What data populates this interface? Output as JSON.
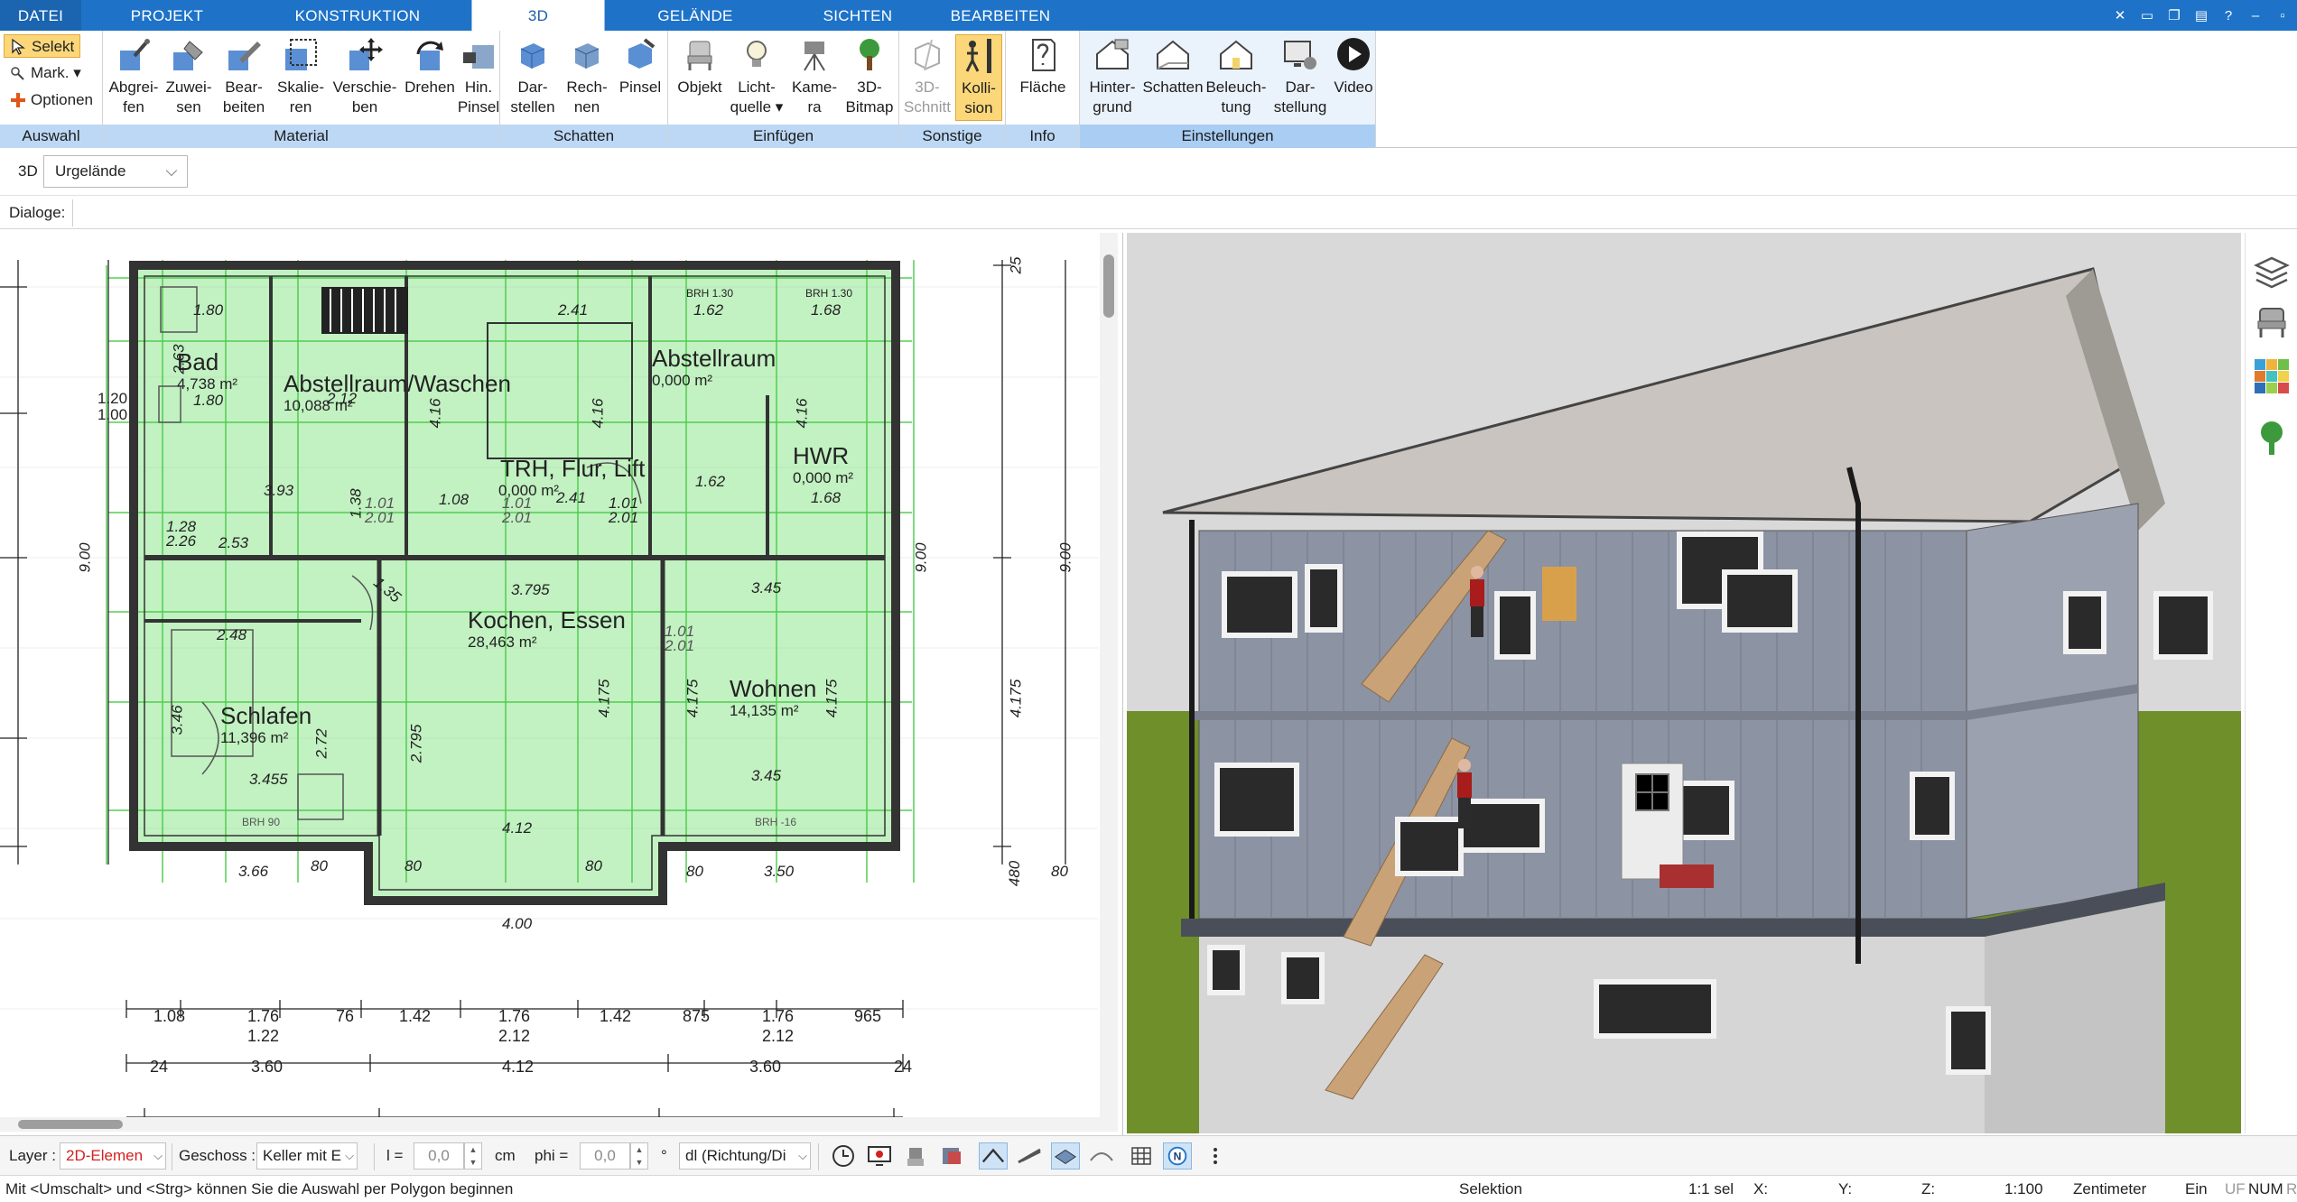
{
  "tabs": [
    {
      "label": "DATEI"
    },
    {
      "label": "PROJEKT"
    },
    {
      "label": "KONSTRUKTION"
    },
    {
      "label": "3D"
    },
    {
      "label": "GELÄNDE"
    },
    {
      "label": "SICHTEN"
    },
    {
      "label": "BEARBEITEN"
    }
  ],
  "window_icons": [
    "tools-icon",
    "window-icon",
    "restore-icon",
    "monitor-icon",
    "help-icon",
    "minimize-icon",
    "maximize-icon"
  ],
  "ribbon": {
    "auswahl": {
      "label": "Auswahl",
      "selekt": "Selekt",
      "mark": "Mark.",
      "optionen": "Optionen"
    },
    "material": {
      "label": "Material",
      "buttons": [
        {
          "l1": "Abgrei-",
          "l2": "fen"
        },
        {
          "l1": "Zuwei-",
          "l2": "sen"
        },
        {
          "l1": "Bear-",
          "l2": "beiten"
        },
        {
          "l1": "Skalie-",
          "l2": "ren"
        },
        {
          "l1": "Verschie-",
          "l2": "ben"
        },
        {
          "l1": "Drehen",
          "l2": ""
        },
        {
          "l1": "Hin.",
          "l2": "Pinsel"
        }
      ]
    },
    "schatten": {
      "label": "Schatten",
      "buttons": [
        {
          "l1": "Dar-",
          "l2": "stellen"
        },
        {
          "l1": "Rech-",
          "l2": "nen"
        },
        {
          "l1": "Pinsel",
          "l2": ""
        }
      ]
    },
    "einfuegen": {
      "label": "Einfügen",
      "buttons": [
        {
          "l1": "Objekt",
          "l2": ""
        },
        {
          "l1": "Licht-",
          "l2": "quelle ▾"
        },
        {
          "l1": "Kame-",
          "l2": "ra"
        },
        {
          "l1": "3D-",
          "l2": "Bitmap"
        }
      ]
    },
    "sonstige": {
      "label": "Sonstige",
      "buttons": [
        {
          "l1": "3D-",
          "l2": "Schnitt"
        },
        {
          "l1": "Kolli-",
          "l2": "sion"
        }
      ]
    },
    "info": {
      "label": "Info",
      "buttons": [
        {
          "l1": "Fläche",
          "l2": ""
        }
      ]
    },
    "einstellungen": {
      "label": "Einstellungen",
      "buttons": [
        {
          "l1": "Hinter-",
          "l2": "grund"
        },
        {
          "l1": "Schatten",
          "l2": ""
        },
        {
          "l1": "Beleuch-",
          "l2": "tung"
        },
        {
          "l1": "Dar-",
          "l2": "stellung"
        },
        {
          "l1": "Video",
          "l2": ""
        }
      ]
    }
  },
  "subbar": {
    "view_label": "3D",
    "terrain_value": "Urgelände",
    "dialog_label": "Dialoge:"
  },
  "plan": {
    "rooms": [
      {
        "name": "Bad",
        "area": "4,738 m²"
      },
      {
        "name": "Abstellraum/Waschen",
        "area": "10,088 m²"
      },
      {
        "name": "Abstellraum",
        "area": "0,000 m²"
      },
      {
        "name": "TRH, Flur, Lift",
        "area": "0,000 m²"
      },
      {
        "name": "HWR",
        "area": "0,000 m²"
      },
      {
        "name": "Kochen, Essen",
        "area": "28,463 m²"
      },
      {
        "name": "Wohnen",
        "area": "14,135 m²"
      },
      {
        "name": "Schlafen",
        "area": "11,396 m²"
      }
    ],
    "dims": {
      "d180a": "1.80",
      "d241": "2.41",
      "d162": "1.62",
      "d168": "1.68",
      "brh130a": "BRH 1.30",
      "brh130b": "BRH 1.30",
      "d263": "2.63",
      "d180b": "1.80",
      "d212": "2.12",
      "d416a": "4.16",
      "d416b": "4.16",
      "d416c": "4.16",
      "d120": "1.20",
      "d100": "1.00",
      "d393": "3.93",
      "d138": "1.38",
      "d108": "1.08",
      "d101a": "1.01",
      "d201a": "2.01",
      "d101b": "1.01",
      "d201b": "2.01",
      "d241b": "2.41",
      "d101c": "1.01",
      "d201c": "2.01",
      "d162b": "1.62",
      "d168b": "1.68",
      "d253": "2.53",
      "d128": "1.28",
      "d226": "2.26",
      "d900a": "9.00",
      "d900b": "9.00",
      "d900c": "9.00",
      "d379": "3.795",
      "d345a": "3.45",
      "d248": "2.48",
      "d135": "1.35",
      "d101d": "1.01",
      "d201d": "2.01",
      "d346": "3.46",
      "d272": "2.72",
      "d279": "2.795",
      "d417a": "4.175",
      "d417b": "4.175",
      "d417c": "4.175",
      "d417d": "4.175",
      "d345b": "3.455",
      "d345c": "3.45",
      "brh90": "BRH 90",
      "brh16": "BRH -16",
      "d412a": "4.12",
      "d80a": "80",
      "d80b": "80",
      "d80c": "80",
      "d80d": "80",
      "d80e": "80",
      "d366": "3.66",
      "d350": "3.50",
      "d400": "4.00",
      "d25": "25",
      "d480": "480",
      "b108": "1.08",
      "b176a": "1.76",
      "b122": "1.22",
      "b76": "76",
      "b142a": "1.42",
      "b176b": "1.76",
      "b212": "2.12",
      "b142b": "1.42",
      "b87": "875",
      "b176c": "1.76",
      "b212b": "2.12",
      "b96": "965",
      "b24a": "24",
      "b360a": "3.60",
      "b412": "4.12",
      "b360b": "3.60",
      "b24b": "24"
    }
  },
  "rightbar_icons": [
    "layers-icon",
    "furniture-icon",
    "materials-icon",
    "tree-icon"
  ],
  "bottombar": {
    "layer_label": "Layer :",
    "layer_value": "2D-Elemen",
    "geschoss_label": "Geschoss :",
    "geschoss_value": "Keller mit E",
    "l_label": "l =",
    "l_value": "0,0",
    "l_unit": "cm",
    "phi_label": "phi =",
    "phi_value": "0,0",
    "phi_unit": "°",
    "direction_value": "dl (Richtung/Di",
    "accent_red": "#d42020"
  },
  "statusbar": {
    "hint": "Mit <Umschalt> und <Strg> können Sie die Auswahl per Polygon beginnen",
    "mode": "Selektion",
    "sel": "1:1 sel",
    "x": "X:",
    "y": "Y:",
    "z": "Z:",
    "scale": "1:100",
    "unit": "Zentimeter",
    "ein": "Ein",
    "uf": "UF",
    "num": "NUM",
    "r": "R"
  },
  "colors": {
    "ribbon_blue": "#1e73c8",
    "group_label_bg": "#bcd8f5",
    "active_button": "#fbd77a",
    "plan_green": "#7ee07e",
    "sky": "#d8d8d8",
    "grass": "#6f8f2a"
  }
}
